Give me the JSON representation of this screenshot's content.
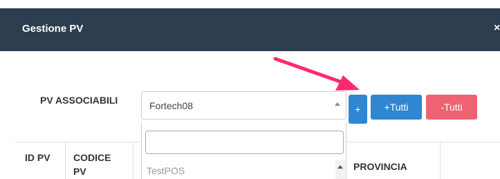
{
  "modal": {
    "title": "Gestione PV",
    "close_label": "×"
  },
  "form": {
    "label": "PV ASSOCIABILI",
    "selected_value": "Fortech08",
    "search_value": "",
    "options": [
      "TestPOS"
    ]
  },
  "buttons": {
    "add": "+",
    "add_all": "+Tutti",
    "remove_all": "-Tutti"
  },
  "table": {
    "headers": [
      "ID PV",
      "CODICE PV",
      "PROVINCIA"
    ]
  },
  "colors": {
    "header_bg": "#2c3e50",
    "primary": "#2f86d2",
    "danger": "#ee6371",
    "annotation_arrow": "#ff2a6d"
  }
}
